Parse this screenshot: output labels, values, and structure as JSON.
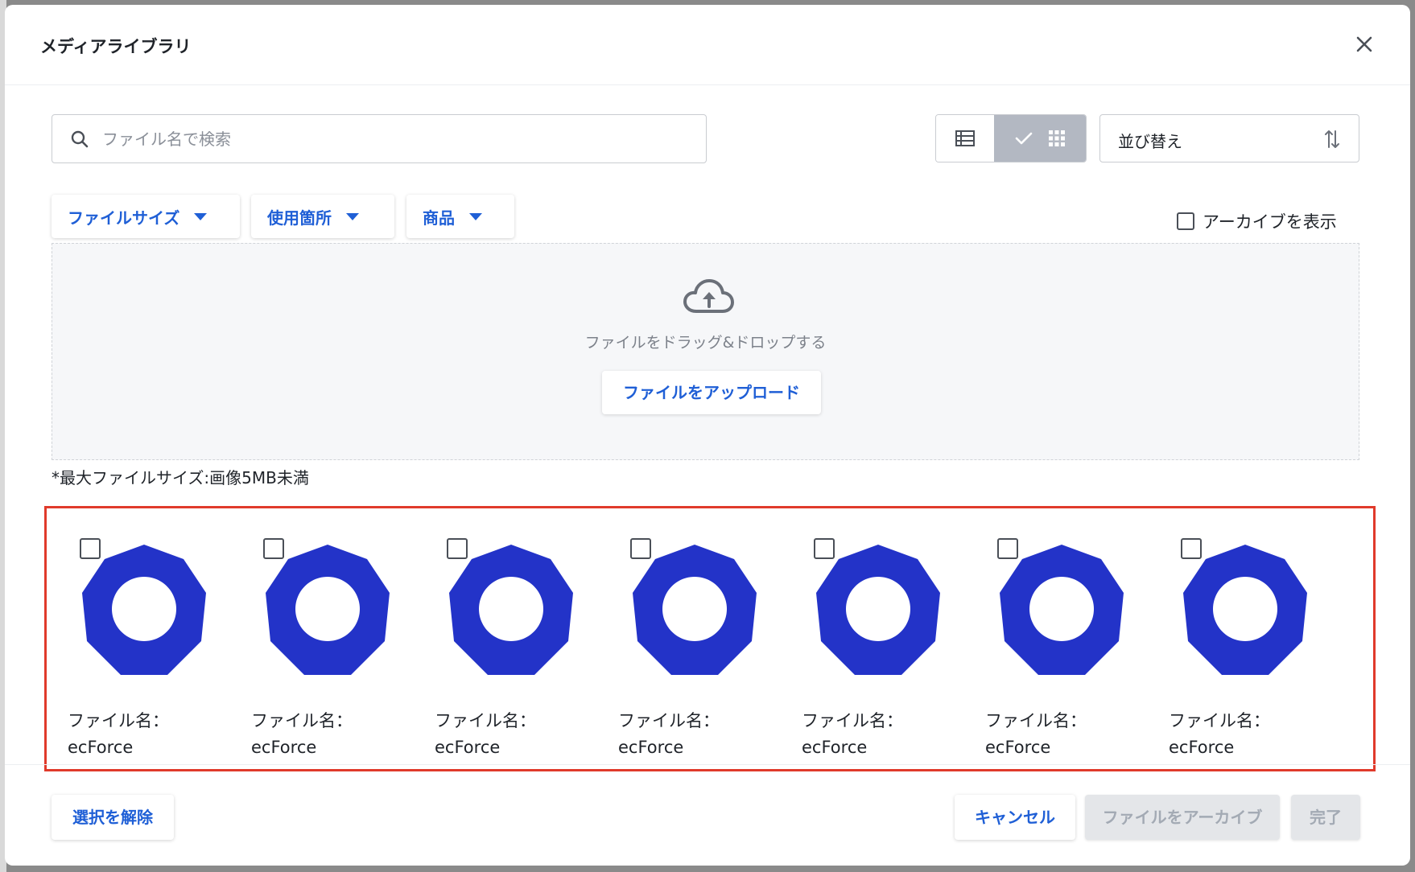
{
  "modal": {
    "title": "メディアライブラリ"
  },
  "search": {
    "placeholder": "ファイル名で検索"
  },
  "view_toggle": {
    "active": "grid"
  },
  "sort": {
    "label": "並び替え"
  },
  "filters": [
    {
      "label": "ファイルサイズ"
    },
    {
      "label": "使用箇所"
    },
    {
      "label": "商品"
    }
  ],
  "archive_toggle": {
    "label": "アーカイブを表示",
    "checked": false
  },
  "dropzone": {
    "text": "ファイルをドラッグ&ドロップする",
    "upload_label": "ファイルをアップロード"
  },
  "max_size_note": "*最大ファイルサイズ:画像5MB未満",
  "files": [
    {
      "name_label": "ファイル名：",
      "name": "ecForce",
      "checked": false
    },
    {
      "name_label": "ファイル名：",
      "name": "ecForce",
      "checked": false
    },
    {
      "name_label": "ファイル名：",
      "name": "ecForce",
      "checked": false
    },
    {
      "name_label": "ファイル名：",
      "name": "ecForce",
      "checked": false
    },
    {
      "name_label": "ファイル名：",
      "name": "ecForce",
      "checked": false
    },
    {
      "name_label": "ファイル名：",
      "name": "ecForce",
      "checked": false
    },
    {
      "name_label": "ファイル名：",
      "name": "ecForce",
      "checked": false
    }
  ],
  "footer": {
    "deselect_label": "選択を解除",
    "cancel_label": "キャンセル",
    "archive_label": "ファイルをアーカイブ",
    "done_label": "完了"
  },
  "colors": {
    "accent": "#1f5fd6",
    "thumbnail": "#2333c8",
    "highlight_border": "#e03a2b",
    "disabled_bg": "#e4e6e9"
  },
  "icons": {
    "close": "close-icon",
    "search": "search-icon",
    "list_view": "list-view-icon",
    "grid_view": "grid-view-icon",
    "check": "check-icon",
    "sort": "sort-arrows-icon",
    "upload": "cloud-upload-icon"
  }
}
